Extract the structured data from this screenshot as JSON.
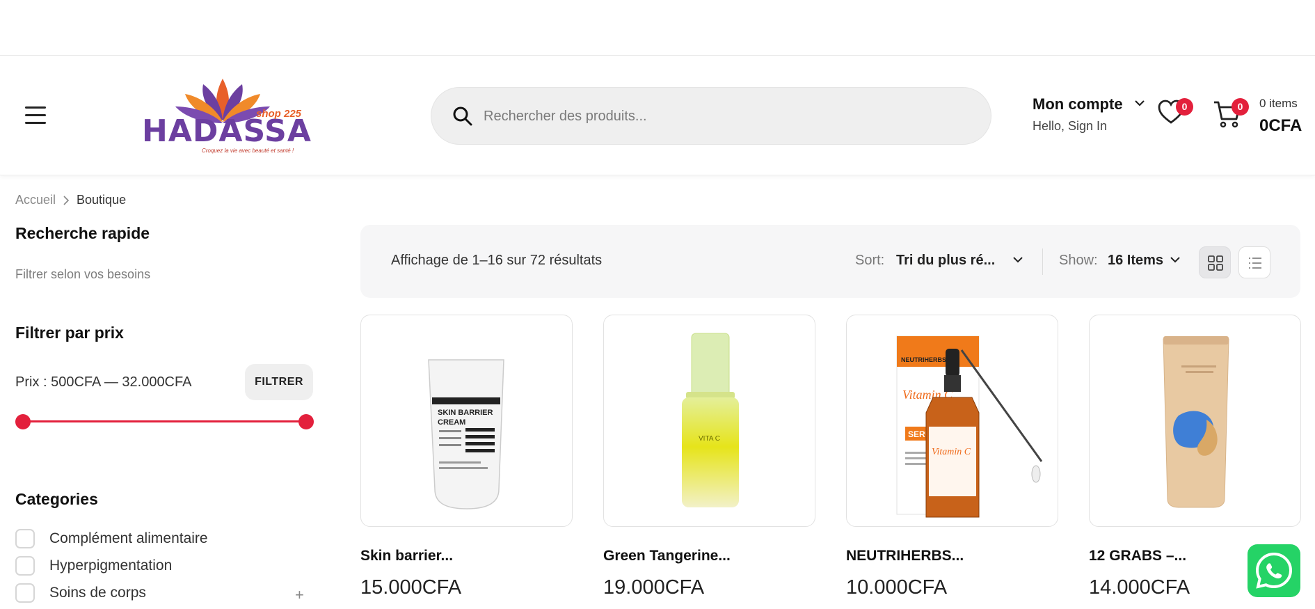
{
  "header": {
    "logo": {
      "brand": "HADASSA",
      "sub": "shop 225",
      "tagline": "Croquez la vie avec beauté et santé !"
    },
    "search": {
      "placeholder": "Rechercher des produits..."
    },
    "account": {
      "title": "Mon compte",
      "subtitle": "Hello, Sign In"
    },
    "wishlist": {
      "count": "0"
    },
    "cart": {
      "count": "0",
      "items": "0 items",
      "total": "0CFA"
    }
  },
  "breadcrumb": {
    "home": "Accueil",
    "current": "Boutique"
  },
  "sidebar": {
    "quick_title": "Recherche rapide",
    "quick_sub": "Filtrer selon vos besoins",
    "price_title": "Filtrer par prix",
    "price_label": "Prix : 500CFA — 32.000CFA",
    "filter_button": "FILTRER",
    "categories_title": "Categories",
    "categories": [
      {
        "label": "Complément alimentaire"
      },
      {
        "label": "Hyperpigmentation"
      },
      {
        "label": "Soins de corps"
      }
    ]
  },
  "toolbar": {
    "result_count": "Affichage de 1–16 sur 72 résultats",
    "sort_label": "Sort:",
    "sort_value": "Tri du plus ré...",
    "show_label": "Show:",
    "show_value": "16 Items"
  },
  "products": [
    {
      "name": "Skin barrier...",
      "price": "15.000CFA",
      "image_text": [
        "SKIN BARRIER",
        "CREAM"
      ]
    },
    {
      "name": "Green Tangerine...",
      "price": "19.000CFA",
      "image_text": [
        "VITA C"
      ]
    },
    {
      "name": "NEUTRIHERBS...",
      "price": "10.000CFA",
      "image_text": [
        "NEUTRIHERBS",
        "Vitamin C",
        "SERUM"
      ]
    },
    {
      "name": "12 GRABS –...",
      "price": "14.000CFA",
      "image_text": []
    }
  ],
  "colors": {
    "accent": "#e3203c",
    "toolbar_bg": "#f6f6f7",
    "whatsapp": "#25d366"
  }
}
